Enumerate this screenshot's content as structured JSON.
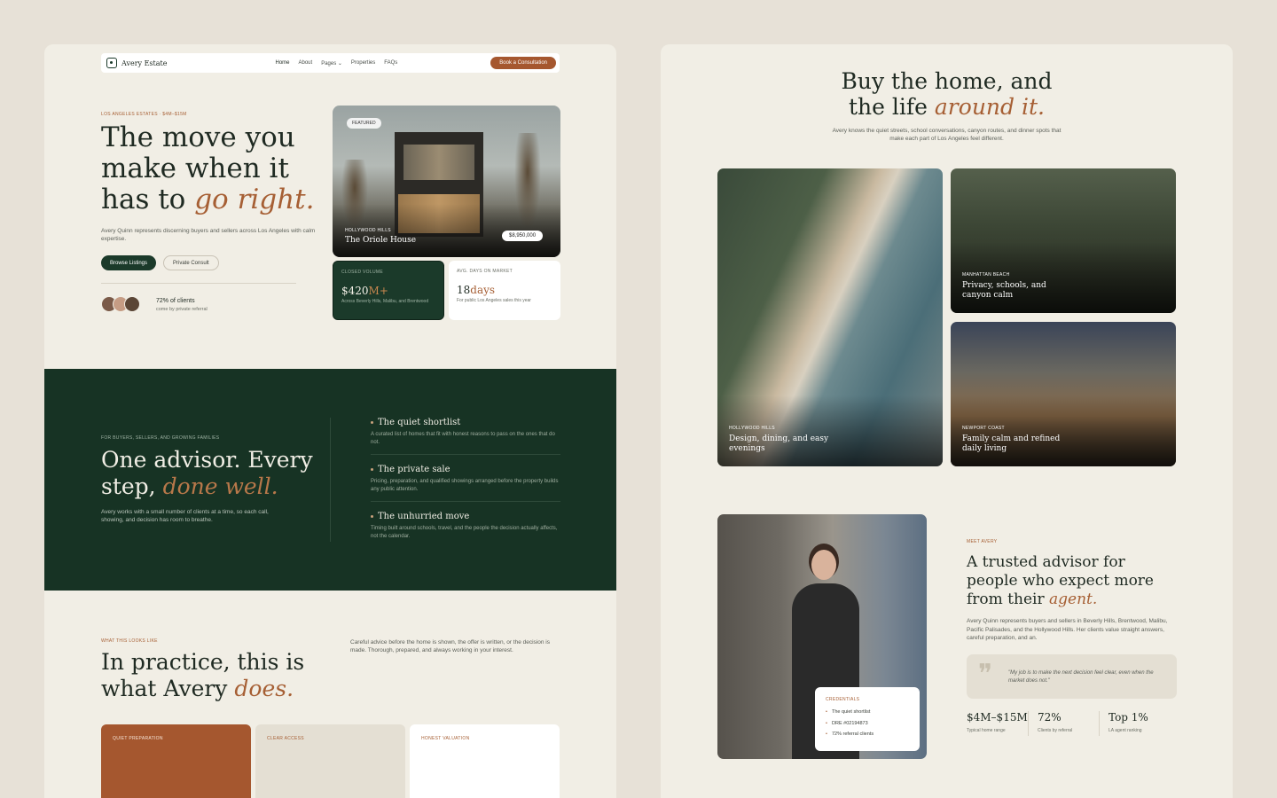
{
  "colors": {
    "accent": "#a65f34",
    "dark_green": "#173324",
    "cream": "#f1eee5",
    "background": "#e7e1d7"
  },
  "nav": {
    "brand": "Avery Estate",
    "logo_icon": "house-icon",
    "links": [
      "Home",
      "About",
      "Pages",
      "Properties",
      "FAQs"
    ],
    "cta": "Book a Consultation"
  },
  "hero": {
    "eyebrow": "LOS ANGELES ESTATES · $4M–$15M",
    "title_plain": "The move you make when it has to",
    "title_accent": "go right.",
    "subtitle": "Avery Quinn represents discerning buyers and sellers across Los Angeles with calm expertise.",
    "primary_button": "Browse Listings",
    "secondary_button": "Private Consult",
    "proof_main": "72% of clients",
    "proof_sub": "come by private referral"
  },
  "featured": {
    "chip": "FEATURED",
    "location": "HOLLYWOOD HILLS",
    "name": "The Oriole House",
    "price": "$8,950,000"
  },
  "stats": [
    {
      "label": "CLOSED VOLUME",
      "value": "$420",
      "suffix": "M+",
      "note": "Across Beverly Hills, Malibu, and Brentwood"
    },
    {
      "label": "AVG. DAYS ON MARKET",
      "value": "18",
      "suffix": "days",
      "note": "For public Los Angeles sales this year"
    }
  ],
  "band": {
    "eyebrow": "FOR BUYERS, SELLERS, AND GROWING FAMILIES",
    "title_plain": "One advisor. Every step,",
    "title_accent": "done well.",
    "paragraph": "Avery works with a small number of clients at a time, so each call, showing, and decision has room to breathe.",
    "features": [
      {
        "title": "The quiet shortlist",
        "desc": "A curated list of homes that fit with honest reasons to pass on the ones that do not."
      },
      {
        "title": "The private sale",
        "desc": "Pricing, preparation, and qualified showings arranged before the property builds any public attention."
      },
      {
        "title": "The unhurried move",
        "desc": "Timing built around schools, travel, and the people the decision actually affects, not the calendar."
      }
    ]
  },
  "practice": {
    "eyebrow": "WHAT THIS LOOKS LIKE",
    "title_plain": "In practice, this is what Avery",
    "title_accent": "does.",
    "paragraph": "Careful advice before the home is shown, the offer is written, or the decision is made. Thorough, prepared, and always working in your interest.",
    "cards": [
      "QUIET PREPARATION",
      "CLEAR ACCESS",
      "HONEST VALUATION"
    ]
  },
  "lifestyle": {
    "title_line1": "Buy the home, and",
    "title_line2_plain": "the life",
    "title_accent": "around it.",
    "subtitle": "Avery knows the quiet streets, school conversations, canyon routes, and dinner spots that make each part of Los Angeles feel different.",
    "tiles": [
      {
        "label": "HOLLYWOOD HILLS",
        "title": "Design, dining, and easy evenings"
      },
      {
        "label": "MANHATTAN BEACH",
        "title": "Privacy, schools, and canyon calm"
      },
      {
        "label": "NEWPORT COAST",
        "title": "Family calm and refined daily living"
      }
    ]
  },
  "meet": {
    "eyebrow": "MEET AVERY",
    "title_plain": "A trusted advisor for people who expect more from their",
    "title_accent": "agent.",
    "paragraph": "Avery Quinn represents buyers and sellers in Beverly Hills, Brentwood, Malibu, Pacific Palisades, and the Hollywood Hills. Her clients value straight answers, careful preparation, and an.",
    "quote": "\"My job is to make the next decision feel clear, even when the market does not.\"",
    "credentials_label": "CREDENTIALS",
    "credentials": [
      "The quiet shortlist",
      "DRE #02194873",
      "72% referral clients"
    ],
    "kpis": [
      {
        "value": "$4M–$15M",
        "label": "Typical home range"
      },
      {
        "value": "72%",
        "label": "Clients by referral"
      },
      {
        "value": "Top 1%",
        "label": "LA agent ranking"
      }
    ]
  }
}
